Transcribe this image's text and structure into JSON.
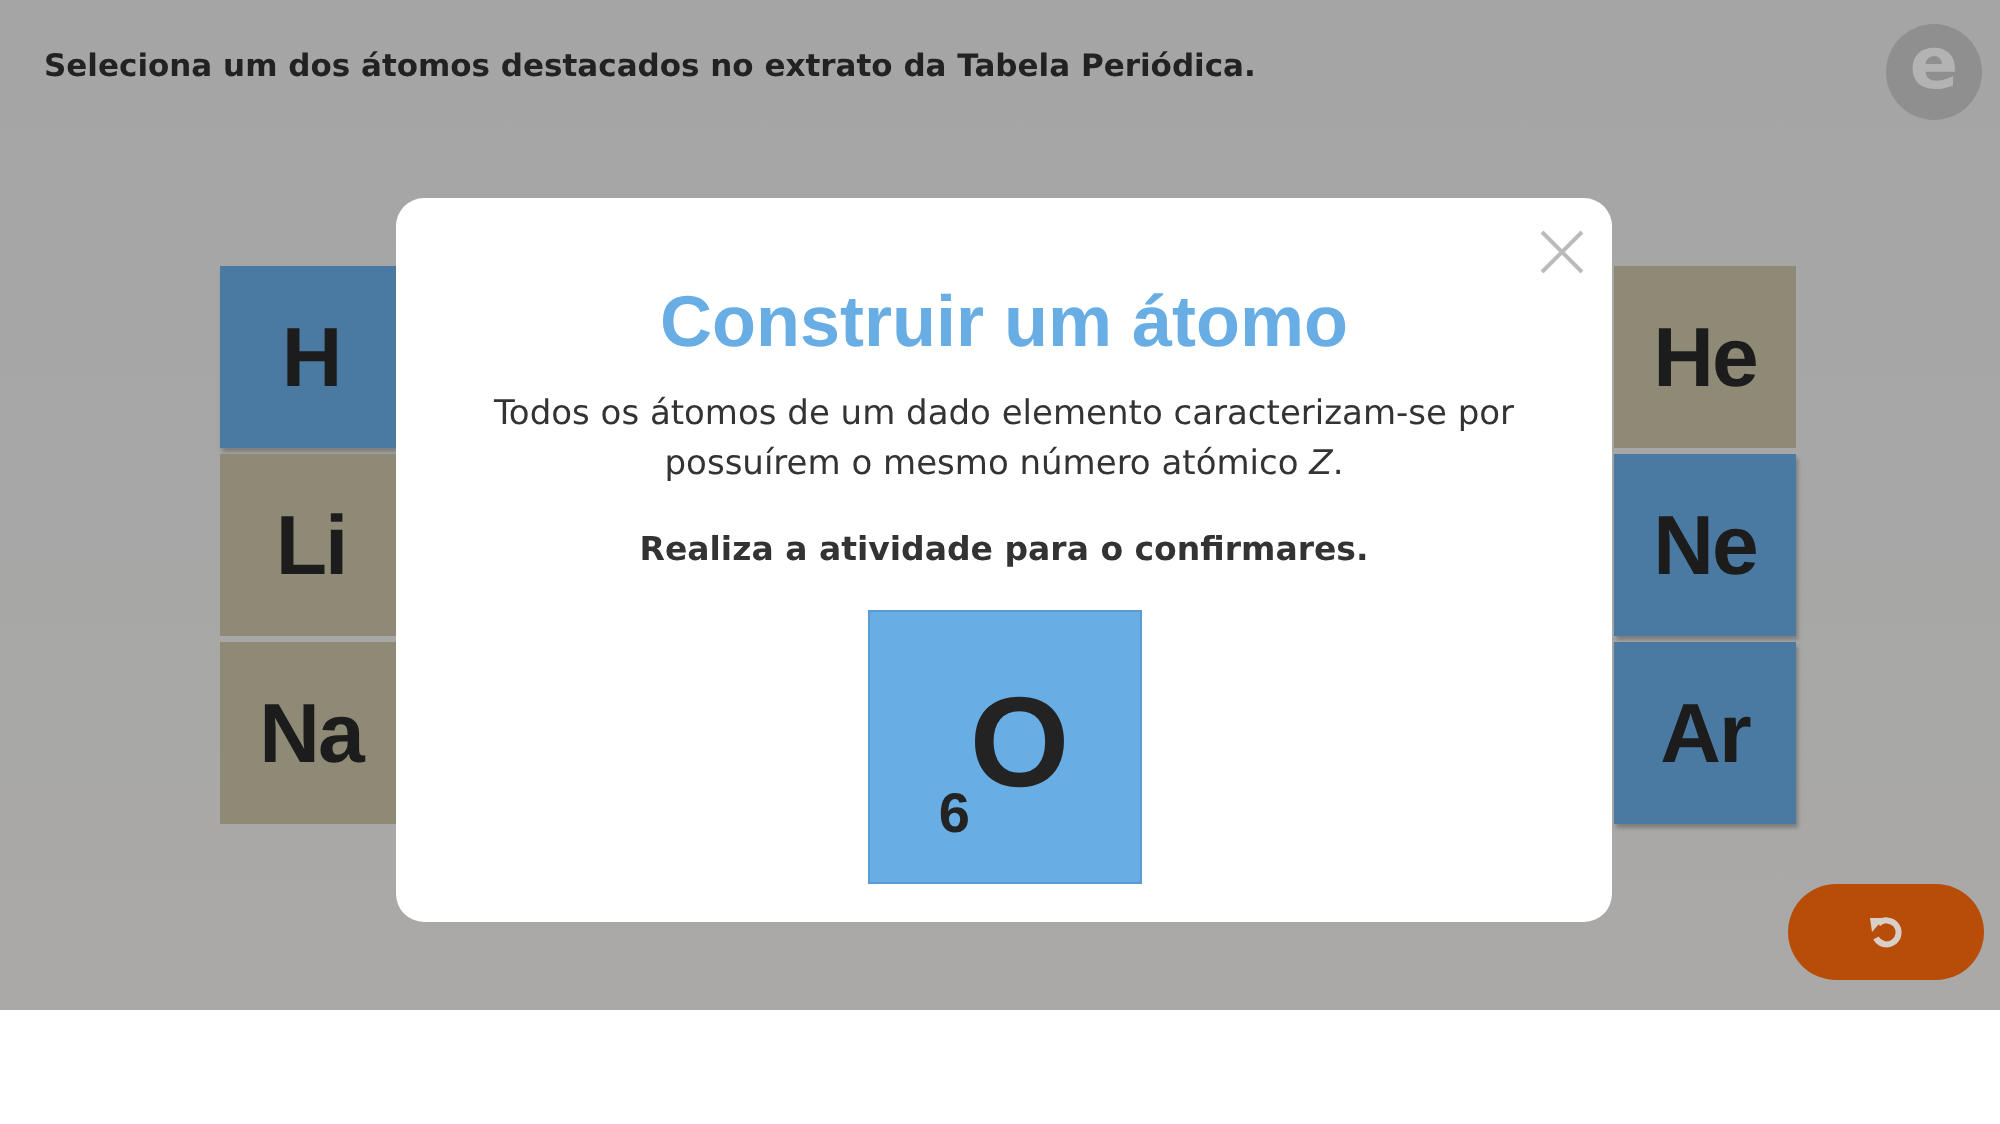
{
  "header": {
    "instruction": "Seleciona um dos átomos destacados no extrato da Tabela Periódica."
  },
  "logo": {
    "letter": "e"
  },
  "tiles_left": [
    {
      "symbol": "H",
      "highlighted": true
    },
    {
      "symbol": "Li",
      "highlighted": false
    },
    {
      "symbol": "Na",
      "highlighted": false
    }
  ],
  "tiles_right": [
    {
      "symbol": "He",
      "highlighted": false
    },
    {
      "symbol": "Ne",
      "highlighted": true
    },
    {
      "symbol": "Ar",
      "highlighted": true
    }
  ],
  "modal": {
    "title": "Construir um átomo",
    "text": "Todos os átomos de um dado elemento caracterizam-se por possuírem o mesmo número atómico *Z*.",
    "note": "Realiza a atividade para o confirmares.",
    "tile": {
      "symbol": "O",
      "number": "6"
    }
  }
}
